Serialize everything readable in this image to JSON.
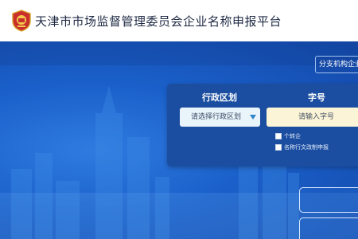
{
  "header": {
    "title": "天津市市场监督管理委员会企业名称申报平台"
  },
  "hero": {
    "branch_button_label": "分支机构企业",
    "form": {
      "district_label": "行政区划",
      "district_select_value": "请选择行政区划",
      "zihao_label": "字号",
      "zihao_placeholder": "请输入字号",
      "option1_label": "个转企",
      "option2_label": "名称行文改制申报"
    }
  },
  "colors": {
    "hero_blue": "#1a5fc9",
    "panel_blue": "#1b4ea0",
    "select_bg": "#eaf4fb",
    "input_bg": "#fbf4d6"
  }
}
